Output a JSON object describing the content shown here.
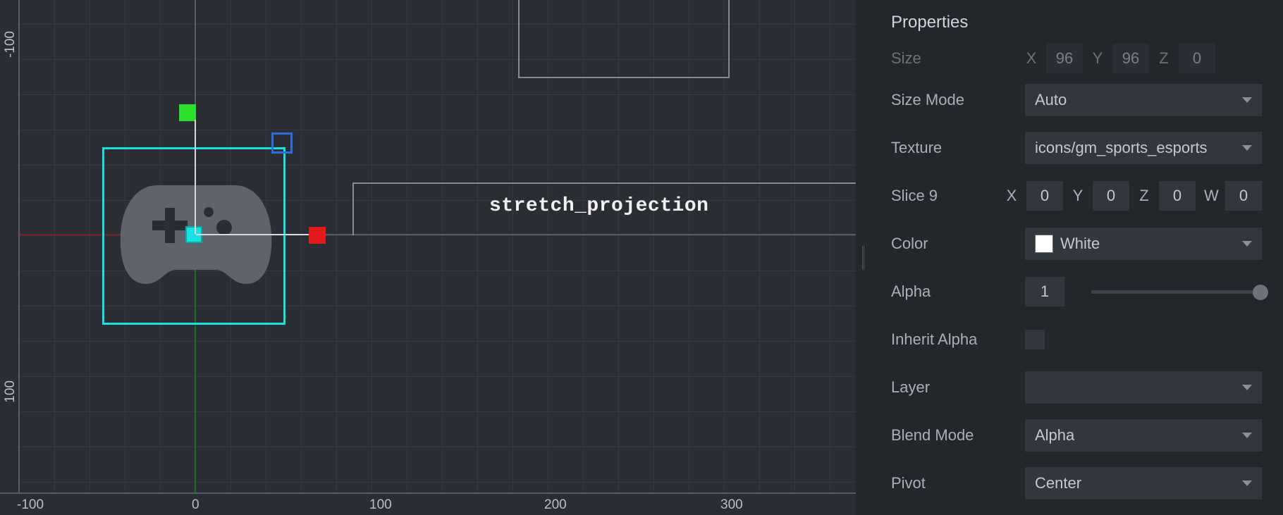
{
  "viewport": {
    "ruler_bottom": {
      "n100": "-100",
      "v0": "0",
      "v100": "100",
      "v200": "200",
      "v300": "300"
    },
    "ruler_left": {
      "nA": "-100",
      "nB": "100"
    },
    "node_label": "stretch_projection"
  },
  "inspector": {
    "title": "Properties",
    "size": {
      "label": "Size",
      "x_lbl": "X",
      "x": "96",
      "y_lbl": "Y",
      "y": "96",
      "z_lbl": "Z",
      "z": "0"
    },
    "size_mode": {
      "label": "Size Mode",
      "value": "Auto"
    },
    "texture": {
      "label": "Texture",
      "value": "icons/gm_sports_esports"
    },
    "slice9": {
      "label": "Slice 9",
      "x_lbl": "X",
      "x": "0",
      "y_lbl": "Y",
      "y": "0",
      "z_lbl": "Z",
      "z": "0",
      "w_lbl": "W",
      "w": "0"
    },
    "color": {
      "label": "Color",
      "value": "White"
    },
    "alpha": {
      "label": "Alpha",
      "value": "1"
    },
    "inherit_alpha": {
      "label": "Inherit Alpha"
    },
    "layer": {
      "label": "Layer",
      "value": ""
    },
    "blend_mode": {
      "label": "Blend Mode",
      "value": "Alpha"
    },
    "pivot": {
      "label": "Pivot",
      "value": "Center"
    }
  }
}
